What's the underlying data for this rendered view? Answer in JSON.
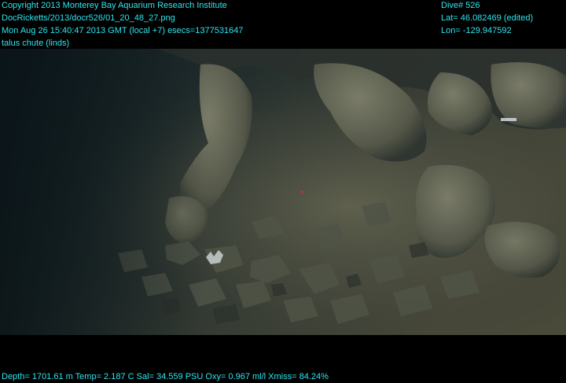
{
  "header_left": {
    "line1": "Copyright 2013 Monterey Bay Aquarium Research Institute",
    "line2": "DocRicketts/2013/docr526/01_20_48_27.png",
    "line3": "Mon Aug 26 15:40:47 2013 GMT (local +7)  esecs=1377531647",
    "line4": "talus chute (linds)"
  },
  "header_right": {
    "dive": "Dive# 526",
    "lat": "Lat= 46.082469 (edited)",
    "lon": "Lon= -129.947592"
  },
  "footer": {
    "sensor_line": "Depth= 1701.61 m  Temp= 2.187 C  Sal= 34.559 PSU  Oxy= 0.967 ml/l  Xmiss= 84.24%"
  },
  "colors": {
    "overlay_text": "#2ee6f0",
    "frame": "#000000",
    "water_deep": "#0f1d22",
    "rock_light": "#6f7462"
  }
}
